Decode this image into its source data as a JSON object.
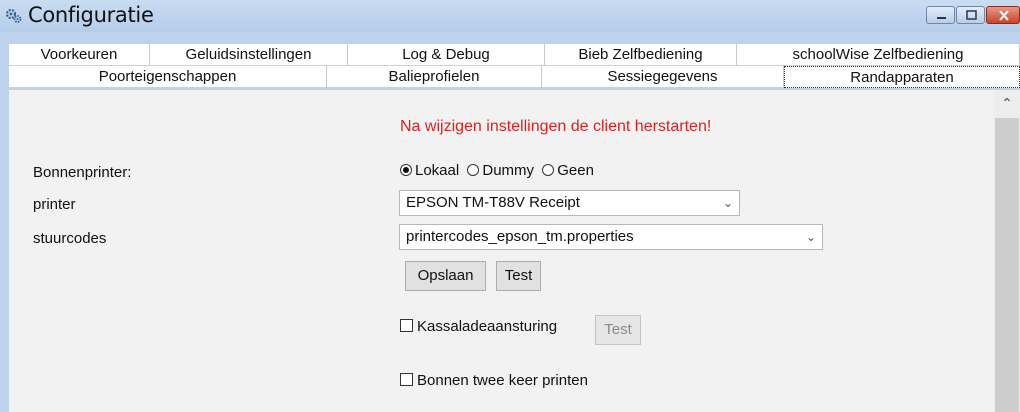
{
  "window": {
    "title": "Configuratie",
    "icon": "gears-icon",
    "controls": [
      "minimize-icon",
      "maximize-icon",
      "close-icon"
    ]
  },
  "tabs_row1": [
    {
      "label": "Voorkeuren"
    },
    {
      "label": "Geluidsinstellingen"
    },
    {
      "label": "Log & Debug"
    },
    {
      "label": "Bieb Zelfbediening"
    },
    {
      "label": "schoolWise Zelfbediening"
    }
  ],
  "tabs_row2": [
    {
      "label": "Poorteigenschappen"
    },
    {
      "label": "Balieprofielen"
    },
    {
      "label": "Sessiegegevens"
    },
    {
      "label": "Randapparaten",
      "active": true
    }
  ],
  "content": {
    "warning": "Na wijzigen instellingen de client herstarten!",
    "bonnenprinter_label": "Bonnenprinter:",
    "radio_options": [
      {
        "label": "Lokaal",
        "selected": true
      },
      {
        "label": "Dummy",
        "selected": false
      },
      {
        "label": "Geen",
        "selected": false
      }
    ],
    "printer_label": "printer",
    "printer_value": "EPSON TM-T88V Receipt",
    "stuurcodes_label": "stuurcodes",
    "stuurcodes_value": "printercodes_epson_tm.properties",
    "save_button": "Opslaan",
    "test_button": "Test",
    "kassalade_label": "Kassaladeaansturing",
    "kassalade_checked": false,
    "kassalade_test_button": "Test",
    "bonnen_label": "Bonnen twee keer printen",
    "bonnen_checked": false
  },
  "colors": {
    "warning": "#e02020",
    "titlebar": "#bdd2ec",
    "panel": "#f2f2f2"
  }
}
